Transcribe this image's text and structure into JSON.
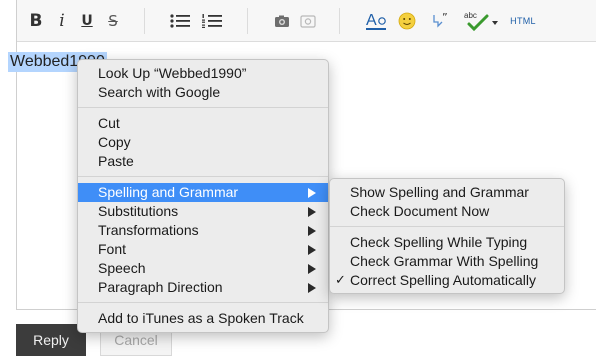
{
  "toolbar": {
    "bold": "B",
    "italic": "i",
    "underline": "U",
    "strike": "S",
    "html": "HTML",
    "abc": "abc"
  },
  "editor": {
    "selected_word": "Webbed1990"
  },
  "context_menu": {
    "items": [
      {
        "label": "Look Up “Webbed1990”"
      },
      {
        "label": "Search with Google"
      },
      {
        "label": "Cut"
      },
      {
        "label": "Copy"
      },
      {
        "label": "Paste"
      },
      {
        "label": "Spelling and Grammar",
        "submenu": true,
        "highlighted": true
      },
      {
        "label": "Substitutions",
        "submenu": true
      },
      {
        "label": "Transformations",
        "submenu": true
      },
      {
        "label": "Font",
        "submenu": true
      },
      {
        "label": "Speech",
        "submenu": true
      },
      {
        "label": "Paragraph Direction",
        "submenu": true
      },
      {
        "label": "Add to iTunes as a Spoken Track"
      }
    ]
  },
  "spelling_submenu": {
    "items": [
      {
        "label": "Show Spelling and Grammar"
      },
      {
        "label": "Check Document Now"
      },
      {
        "label": "Check Spelling While Typing"
      },
      {
        "label": "Check Grammar With Spelling"
      },
      {
        "label": "Correct Spelling Automatically",
        "checked": true
      }
    ],
    "check_mark": "✓"
  },
  "actions": {
    "reply": "Reply",
    "cancel": "Cancel"
  },
  "colors": {
    "highlight": "#3f8ef7",
    "selection": "#b4d5fe",
    "reply_bg": "#3c3c3c",
    "link_blue": "#1f5fa8"
  }
}
